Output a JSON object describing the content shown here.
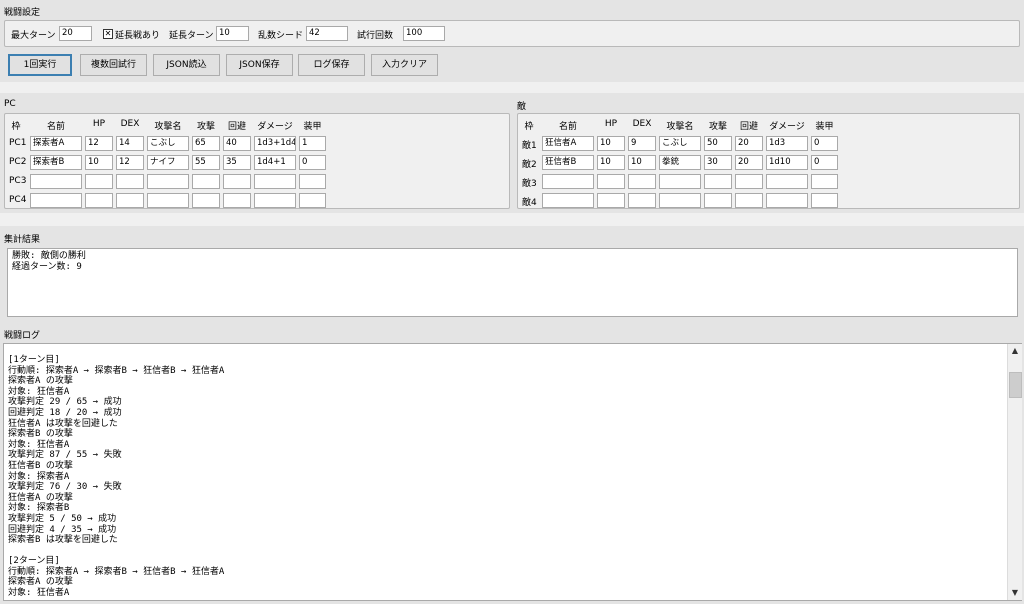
{
  "settings": {
    "title": "戦闘設定",
    "max_turns_label": "最大ターン",
    "max_turns_value": "20",
    "extended_checkbox_label": "延長戦あり",
    "extended_checked_mark": "✕",
    "extend_turns_label": "延長ターン",
    "extend_turns_value": "10",
    "seed_label": "乱数シード",
    "seed_value": "42",
    "trials_label": "試行回数",
    "trials_value": "100"
  },
  "toolbar": {
    "run_once": "1回実行",
    "run_many": "複数回試行",
    "load_json": "JSON読込",
    "save_json": "JSON保存",
    "save_log": "ログ保存",
    "clear_input": "入力クリア"
  },
  "pc": {
    "title": "PC",
    "headers": [
      "枠",
      "名前",
      "HP",
      "DEX",
      "攻撃名",
      "攻撃",
      "回避",
      "ダメージ",
      "装甲"
    ],
    "rows": [
      {
        "slot": "PC1",
        "name": "探索者A",
        "hp": "12",
        "dex": "14",
        "attack_name": "こぶし",
        "attack": "65",
        "evade": "40",
        "damage": "1d3+1d4",
        "armor": "1"
      },
      {
        "slot": "PC2",
        "name": "探索者B",
        "hp": "10",
        "dex": "12",
        "attack_name": "ナイフ",
        "attack": "55",
        "evade": "35",
        "damage": "1d4+1",
        "armor": "0"
      },
      {
        "slot": "PC3",
        "name": "",
        "hp": "",
        "dex": "",
        "attack_name": "",
        "attack": "",
        "evade": "",
        "damage": "",
        "armor": ""
      },
      {
        "slot": "PC4",
        "name": "",
        "hp": "",
        "dex": "",
        "attack_name": "",
        "attack": "",
        "evade": "",
        "damage": "",
        "armor": ""
      }
    ]
  },
  "enemy": {
    "title": "敵",
    "headers": [
      "枠",
      "名前",
      "HP",
      "DEX",
      "攻撃名",
      "攻撃",
      "回避",
      "ダメージ",
      "装甲"
    ],
    "rows": [
      {
        "slot": "敵1",
        "name": "狂信者A",
        "hp": "10",
        "dex": "9",
        "attack_name": "こぶし",
        "attack": "50",
        "evade": "20",
        "damage": "1d3",
        "armor": "0"
      },
      {
        "slot": "敵2",
        "name": "狂信者B",
        "hp": "10",
        "dex": "10",
        "attack_name": "拳銃",
        "attack": "30",
        "evade": "20",
        "damage": "1d10",
        "armor": "0"
      },
      {
        "slot": "敵3",
        "name": "",
        "hp": "",
        "dex": "",
        "attack_name": "",
        "attack": "",
        "evade": "",
        "damage": "",
        "armor": ""
      },
      {
        "slot": "敵4",
        "name": "",
        "hp": "",
        "dex": "",
        "attack_name": "",
        "attack": "",
        "evade": "",
        "damage": "",
        "armor": ""
      }
    ]
  },
  "summary": {
    "title": "集計結果",
    "text": "勝敗: 敵側の勝利\n経過ターン数: 9"
  },
  "log": {
    "title": "戦闘ログ",
    "text": "[1ターン目]\n行動順: 探索者A → 探索者B → 狂信者B → 狂信者A\n探索者A の攻撃\n対象: 狂信者A\n攻撃判定 29 / 65 → 成功\n回避判定 18 / 20 → 成功\n狂信者A は攻撃を回避した\n探索者B の攻撃\n対象: 狂信者A\n攻撃判定 87 / 55 → 失敗\n狂信者B の攻撃\n対象: 探索者A\n攻撃判定 76 / 30 → 失敗\n狂信者A の攻撃\n対象: 探索者B\n攻撃判定 5 / 50 → 成功\n回避判定 4 / 35 → 成功\n探索者B は攻撃を回避した\n\n[2ターン目]\n行動順: 探索者A → 探索者B → 狂信者B → 狂信者A\n探索者A の攻撃\n対象: 狂信者A"
  },
  "icons": {
    "scroll_up": "scroll-up-arrow-icon",
    "scroll_down": "scroll-down-arrow-icon"
  }
}
